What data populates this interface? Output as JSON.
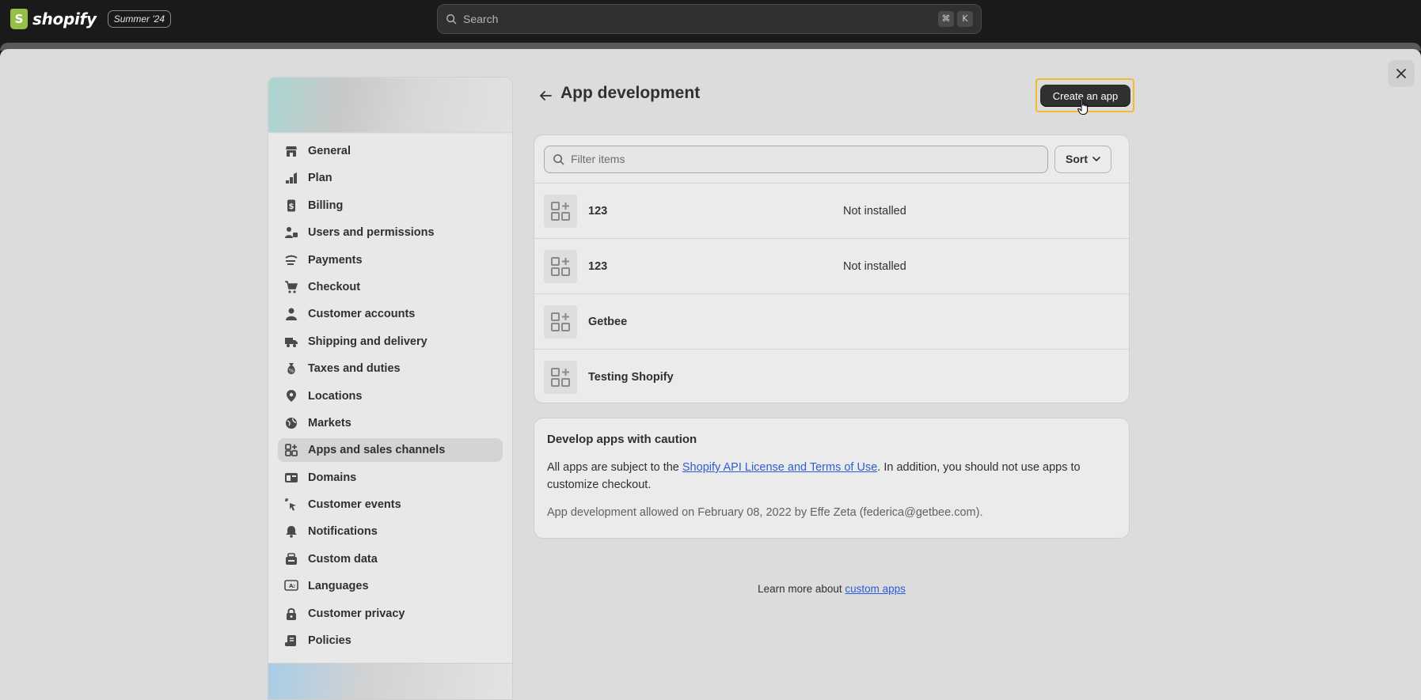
{
  "topbar": {
    "logo_glyph": "S",
    "logo_text": "shopify",
    "edition": "Summer '24",
    "search_placeholder": "Search",
    "shortcut_keys": [
      "⌘",
      "K"
    ]
  },
  "sidebar": {
    "items": [
      {
        "label": "General",
        "icon": "store-icon"
      },
      {
        "label": "Plan",
        "icon": "plan-icon"
      },
      {
        "label": "Billing",
        "icon": "billing-icon"
      },
      {
        "label": "Users and permissions",
        "icon": "users-icon"
      },
      {
        "label": "Payments",
        "icon": "payments-icon"
      },
      {
        "label": "Checkout",
        "icon": "cart-icon"
      },
      {
        "label": "Customer accounts",
        "icon": "person-icon"
      },
      {
        "label": "Shipping and delivery",
        "icon": "truck-icon"
      },
      {
        "label": "Taxes and duties",
        "icon": "tax-icon"
      },
      {
        "label": "Locations",
        "icon": "location-icon"
      },
      {
        "label": "Markets",
        "icon": "globe-icon"
      },
      {
        "label": "Apps and sales channels",
        "icon": "apps-icon",
        "active": true
      },
      {
        "label": "Domains",
        "icon": "domains-icon"
      },
      {
        "label": "Customer events",
        "icon": "cursor-click-icon"
      },
      {
        "label": "Notifications",
        "icon": "bell-icon"
      },
      {
        "label": "Custom data",
        "icon": "custom-data-icon"
      },
      {
        "label": "Languages",
        "icon": "language-icon"
      },
      {
        "label": "Customer privacy",
        "icon": "lock-icon"
      },
      {
        "label": "Policies",
        "icon": "policies-icon"
      }
    ]
  },
  "main": {
    "title": "App development",
    "create_button": "Create an app",
    "filter_placeholder": "Filter items",
    "sort_label": "Sort",
    "apps": [
      {
        "name": "123",
        "status": "Not installed"
      },
      {
        "name": "123",
        "status": "Not installed"
      },
      {
        "name": "Getbee",
        "status": ""
      },
      {
        "name": "Testing Shopify",
        "status": ""
      }
    ],
    "caution": {
      "title": "Develop apps with caution",
      "body_prefix": "All apps are subject to the ",
      "body_link": "Shopify API License and Terms of Use",
      "body_suffix": ". In addition, you should not use apps to customize checkout.",
      "meta": "App development allowed on February 08, 2022 by Effe Zeta (federica@getbee.com)."
    },
    "learn_more_prefix": "Learn more about ",
    "learn_more_link": "custom apps"
  },
  "colors": {
    "accent_focus": "#f5b82e",
    "link": "#2c5dd6",
    "primary_button": "#303030",
    "logo_green": "#95bf47"
  }
}
